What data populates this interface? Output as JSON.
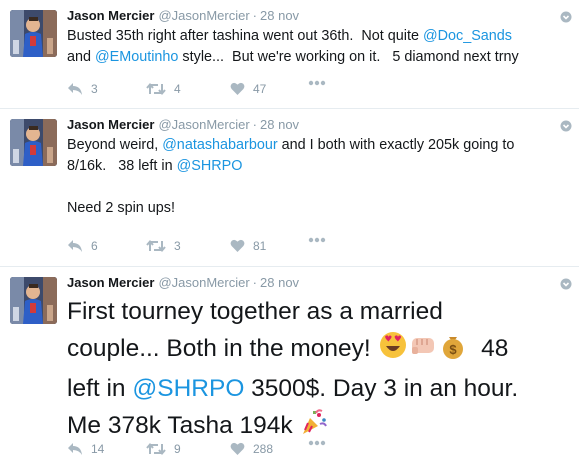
{
  "author": {
    "name": "Jason Mercier",
    "handle": "@JasonMercier",
    "separator": "·"
  },
  "tweets": [
    {
      "time": "28 nov",
      "text_parts": [
        {
          "t": "Busted 35th right after tashina went out 36th.  Not quite "
        },
        {
          "t": "@Doc_Sands",
          "mention": true
        },
        {
          "t": "\nand "
        },
        {
          "t": "@EMoutinho",
          "mention": true
        },
        {
          "t": " style...  But we're working on it.   5 diamond next trny"
        }
      ],
      "replies": "3",
      "retweets": "4",
      "likes": "47"
    },
    {
      "time": "28 nov",
      "text_parts": [
        {
          "t": "Beyond weird, "
        },
        {
          "t": "@natashabarbour",
          "mention": true
        },
        {
          "t": " and I both with exactly 205k going to\n8/16k.   38 left in "
        },
        {
          "t": "@SHRPO",
          "mention": true
        },
        {
          "t": "\n\nNeed 2 spin ups!"
        }
      ],
      "replies": "6",
      "retweets": "3",
      "likes": "81"
    },
    {
      "time": "28 nov",
      "text_parts": [
        {
          "t": "First tourney together as a married\ncouple... Both in the money! "
        },
        {
          "emoji": "heart-eyes"
        },
        {
          "emoji": "punch"
        },
        {
          "emoji": "money-bag"
        },
        {
          "t": "  48\nleft in "
        },
        {
          "t": "@SHRPO",
          "mention": true
        },
        {
          "t": " 3500$. Day 3 in an hour.\nMe 378k Tasha 194k "
        },
        {
          "emoji": "party-popper"
        }
      ],
      "replies": "14",
      "retweets": "9",
      "likes": "288"
    }
  ],
  "icons": {
    "reply": "reply-icon",
    "retweet": "retweet-icon",
    "like": "heart-icon",
    "more": "more-dots-icon",
    "caret": "caret-icon"
  },
  "colors": {
    "link": "#1b95e0",
    "meta": "#8899a6",
    "text": "#14171a",
    "icon": "#aab8c2"
  }
}
